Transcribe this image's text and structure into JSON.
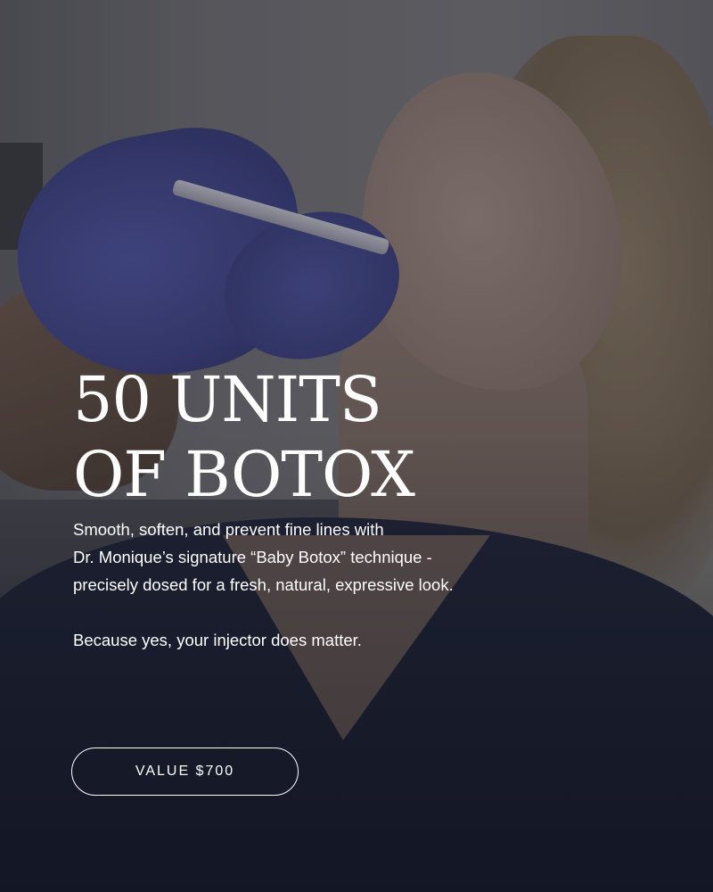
{
  "promo": {
    "headline_line1": "50 UNITS",
    "headline_line2": "OF BOTOX",
    "body_line1": "Smooth, soften, and prevent fine lines with",
    "body_line2": "Dr. Monique’s signature “Baby Botox” technique -",
    "body_line3": "precisely dosed for a fresh, natural, expressive look.",
    "tagline": "Because yes, your injector does matter.",
    "value_label": "VALUE $700"
  },
  "colors": {
    "text": "#ffffff",
    "sweater": "#1a1f31",
    "glove": "#3e4385"
  }
}
